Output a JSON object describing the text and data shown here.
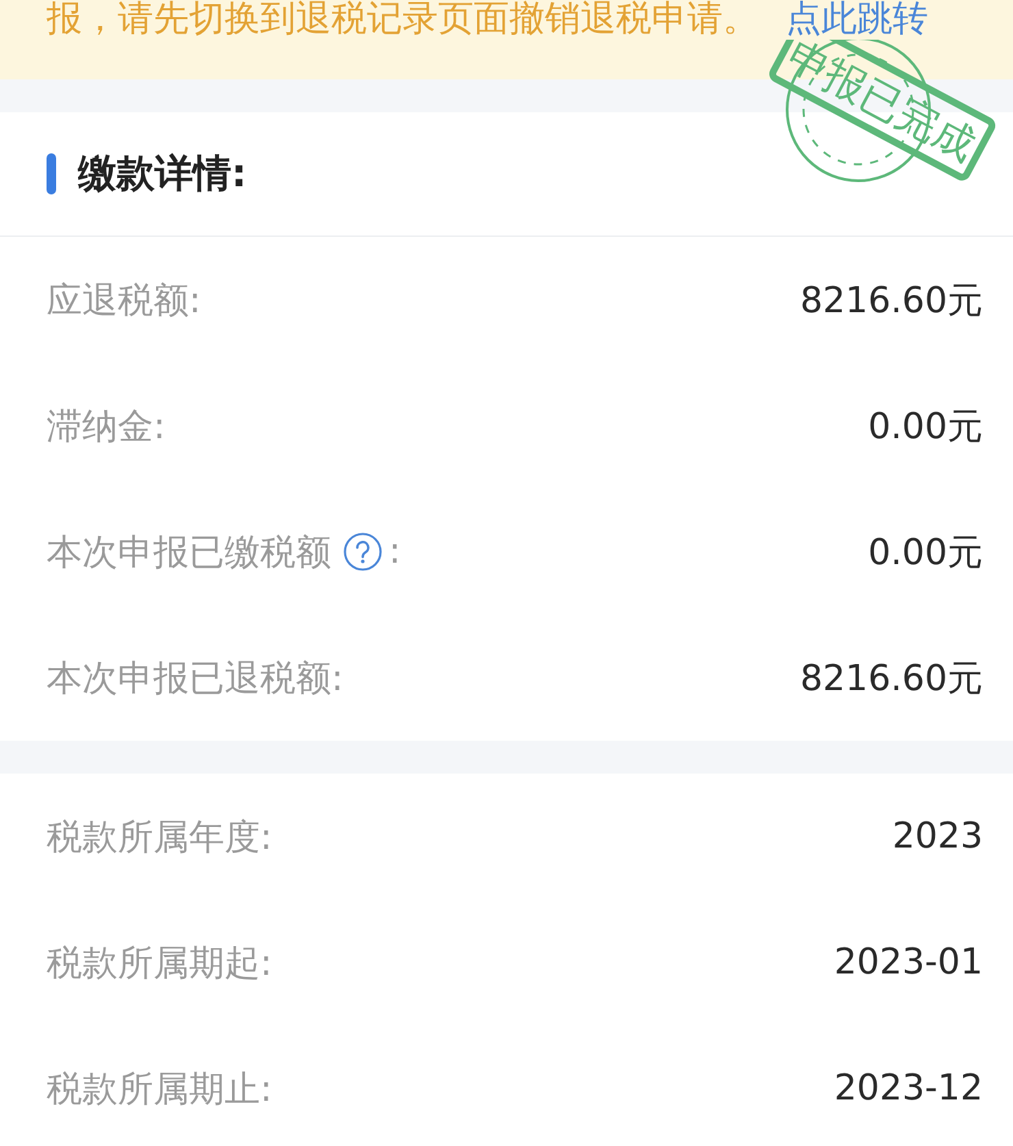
{
  "notice": {
    "text": "报，请先切换到退税记录页面撤销退税申请。",
    "link": "点此跳转"
  },
  "stamp": {
    "text": "申报已完成"
  },
  "payment_section": {
    "title": "缴款详情:",
    "rows": [
      {
        "label": "应退税额:",
        "value": "8216.60元",
        "help": false
      },
      {
        "label": "滞纳金:",
        "value": "0.00元",
        "help": false
      },
      {
        "label": "本次申报已缴税额",
        "colon": ":",
        "value": "0.00元",
        "help": true
      },
      {
        "label": "本次申报已退税额:",
        "value": "8216.60元",
        "help": false
      }
    ]
  },
  "period_section": {
    "rows": [
      {
        "label": "税款所属年度:",
        "value": "2023"
      },
      {
        "label": "税款所属期起:",
        "value": "2023-01"
      },
      {
        "label": "税款所属期止:",
        "value": "2023-12"
      }
    ]
  }
}
